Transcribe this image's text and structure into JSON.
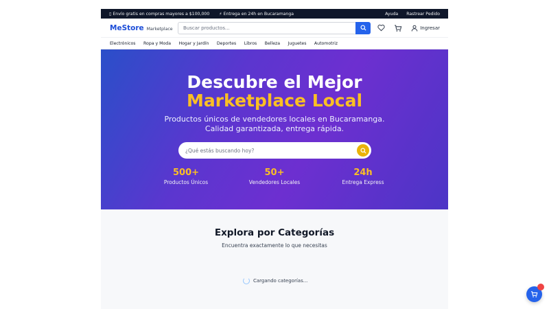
{
  "topbar": {
    "shipping": "Envío gratis en compras mayores a $100,000",
    "delivery": "⚡ Entrega en 24h en Bucaramanga",
    "help": "Ayuda",
    "track": "Rastrear Pedido"
  },
  "header": {
    "logo": "MeStore",
    "logo_sub": "Marketplace",
    "search_placeholder": "Buscar productos...",
    "login": "Ingresar"
  },
  "nav": {
    "items": [
      "Electrónicos",
      "Ropa y Moda",
      "Hogar y Jardín",
      "Deportes",
      "Libros",
      "Belleza",
      "Juguetes",
      "Automotriz"
    ]
  },
  "hero": {
    "title_line1": "Descubre el Mejor",
    "title_line2": "Marketplace Local",
    "subtitle_line1": "Productos únicos de vendedores locales en Bucaramanga.",
    "subtitle_line2": "Calidad garantizada, entrega rápida.",
    "search_placeholder": "¿Qué estás buscando hoy?",
    "stats": [
      {
        "value": "500+",
        "label": "Productos Únicos"
      },
      {
        "value": "50+",
        "label": "Vendedores Locales"
      },
      {
        "value": "24h",
        "label": "Entrega Express"
      }
    ]
  },
  "categories": {
    "title": "Explora por Categorías",
    "subtitle": "Encuentra exactamente lo que necesitas",
    "loading": "Cargando categorías..."
  },
  "colors": {
    "brand_blue": "#2563eb",
    "accent_yellow": "#fbbf24",
    "topbar_bg": "#0f172a"
  }
}
